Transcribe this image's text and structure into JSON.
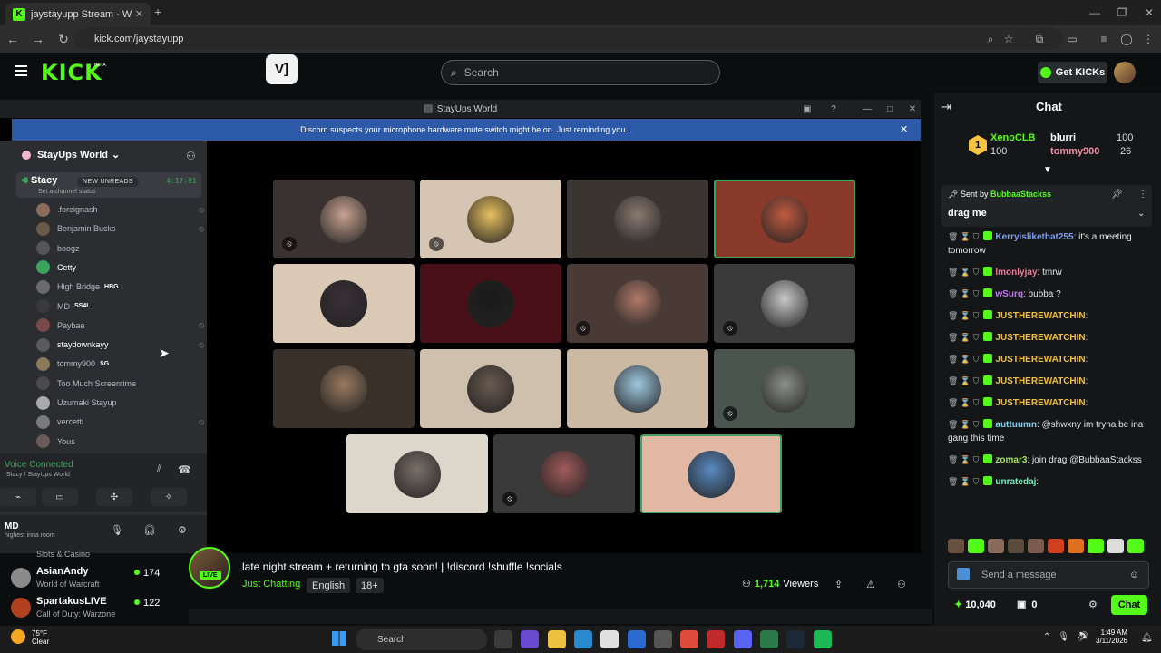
{
  "browser": {
    "tab_title": "jaystayupp Stream - Watch Live",
    "tab_favicon": "K",
    "url": "kick.com/jaystayupp",
    "new_tab": "+"
  },
  "kick": {
    "logo": "KICK",
    "beta": "BETA",
    "app_icon": "V]",
    "search_placeholder": "Search",
    "get_kicks": "Get KICKs"
  },
  "discord": {
    "window_title": "StayUps World",
    "banner": "Discord suspects your microphone hardware mute switch might be on. Just reminding you...",
    "server_name": "StayUps World",
    "channel_name": "Stacy",
    "new_unreads": "NEW UNREADS",
    "channel_time": "4:17:01",
    "channel_status": "Set a channel status",
    "members": [
      {
        "name": ".foreignash",
        "tag": "",
        "color": "#8b6b5a",
        "muted": true
      },
      {
        "name": "Benjamin Bucks",
        "tag": "",
        "color": "#6b5a4a",
        "muted": true
      },
      {
        "name": "boogz",
        "tag": "",
        "color": "#555555",
        "muted": false
      },
      {
        "name": "Cetty",
        "tag": "",
        "color": "#3ba55d",
        "muted": false,
        "bright": true
      },
      {
        "name": "High Bridge",
        "tag": "HBG",
        "color": "#6a6a6a",
        "muted": false
      },
      {
        "name": "MD",
        "tag": "SS4L",
        "color": "#3a3a3a",
        "muted": false
      },
      {
        "name": "Paybae",
        "tag": "",
        "color": "#7a4a4a",
        "muted": true
      },
      {
        "name": "staydownkayy",
        "tag": "",
        "color": "#5a5a5a",
        "muted": true,
        "bright": true
      },
      {
        "name": "tommy900",
        "tag": "SG",
        "color": "#8a7a5a",
        "muted": false
      },
      {
        "name": "Too Much Screentime",
        "tag": "",
        "color": "#4a4a4a",
        "muted": false
      },
      {
        "name": "Uzumaki Stayup",
        "tag": "",
        "color": "#aaaaaa",
        "muted": false
      },
      {
        "name": "vercetti",
        "tag": "",
        "color": "#7a7a7a",
        "muted": true
      },
      {
        "name": "Yous",
        "tag": "",
        "color": "#6a5a5a",
        "muted": false
      }
    ],
    "voice_connected": "Voice Connected",
    "voice_sub": "Stacy / StayUps World",
    "user_name": "MD",
    "user_status": "highest inna room"
  },
  "tiles": [
    {
      "bg": "#3a3230",
      "pic": "#c8a290",
      "muted": true,
      "speaking": false
    },
    {
      "bg": "#d6c5b2",
      "pic": "#e8c060",
      "muted": true,
      "speaking": false
    },
    {
      "bg": "#3a3530",
      "pic": "#8a7a70",
      "muted": false,
      "speaking": false
    },
    {
      "bg": "#8a3a2a",
      "pic": "#c05a40",
      "muted": false,
      "speaking": true
    },
    {
      "bg": "#d9c9b5",
      "pic": "#3a3038",
      "muted": false,
      "speaking": false
    },
    {
      "bg": "#4a1018",
      "pic": "#1a1a1a",
      "muted": false,
      "speaking": false
    },
    {
      "bg": "#4a3a35",
      "pic": "#b07a6a",
      "muted": true,
      "speaking": false
    },
    {
      "bg": "#3a3a3a",
      "pic": "#c8c8c8",
      "muted": true,
      "speaking": false
    },
    {
      "bg": "#3a302a",
      "pic": "#9a7a60",
      "muted": false,
      "speaking": false
    },
    {
      "bg": "#cfc0ad",
      "pic": "#6a5a50",
      "muted": false,
      "speaking": false
    },
    {
      "bg": "#cbb9a4",
      "pic": "#a0c8e0",
      "muted": false,
      "speaking": false
    },
    {
      "bg": "#4a5550",
      "pic": "#8a9088",
      "muted": true,
      "speaking": false
    },
    {
      "bg": "#ddd6cb",
      "pic": "#7a7068",
      "muted": false,
      "speaking": false
    },
    {
      "bg": "#3a3a3a",
      "pic": "#a05a5a",
      "muted": true,
      "speaking": false
    },
    {
      "bg": "#e0b8a4",
      "pic": "#5a8ac0",
      "muted": false,
      "speaking": true
    }
  ],
  "stream": {
    "live": "LIVE",
    "title": "late night stream + returning to gta soon! | !discord !shuffle !socials",
    "category": "Just Chatting",
    "language": "English",
    "rating": "18+",
    "viewers_count": "1,714",
    "viewers_label": "Viewers"
  },
  "sidebar": {
    "partial_label": "Slots & Casino",
    "recommended": [
      {
        "name": "AsianAndy",
        "game": "World of Warcraft",
        "viewers": "174",
        "color": "#8a8a8a"
      },
      {
        "name": "SpartakusLIVE",
        "game": "Call of Duty: Warzone",
        "viewers": "122",
        "color": "#b04020"
      }
    ]
  },
  "chat": {
    "title": "Chat",
    "leaderboard": {
      "rank": "1",
      "first_name": "XenoCLB",
      "first_score": "100",
      "second_name": "blurri",
      "second_score": "100",
      "third_name": "tommy900",
      "third_score": "26"
    },
    "pinned_by_label": "Sent by",
    "pinned_by": "BubbaaStackss",
    "pinned_message": "drag me",
    "messages": [
      {
        "user": "Kerryislikethat255",
        "color": "#7a9cf0",
        "text": ": it's a meeting tomorrow"
      },
      {
        "user": "lmonlyjay",
        "color": "#e87a9a",
        "text": ": tmrw"
      },
      {
        "user": "wSurq",
        "color": "#c07af0",
        "text": ": bubba ?"
      },
      {
        "user": "JUSTHEREWATCHIN",
        "color": "#f0c040",
        "text": ":"
      },
      {
        "user": "JUSTHEREWATCHIN",
        "color": "#f0c040",
        "text": ":"
      },
      {
        "user": "JUSTHEREWATCHIN",
        "color": "#f0c040",
        "text": ":"
      },
      {
        "user": "JUSTHEREWATCHIN",
        "color": "#f0c040",
        "text": ":"
      },
      {
        "user": "JUSTHEREWATCHIN",
        "color": "#f0c040",
        "text": ":"
      },
      {
        "user": "auttuumn",
        "color": "#7ad0f0",
        "text": ": @shwxny im tryna be ina gang this time"
      },
      {
        "user": "zomar3",
        "color": "#a0e060",
        "text": ": join drag @BubbaaStackss"
      },
      {
        "user": "unratedaj",
        "color": "#7af0c0",
        "text": ":"
      }
    ],
    "send_placeholder": "Send a message",
    "points": "10,040",
    "kicks": "0",
    "chat_button": "Chat"
  },
  "taskbar": {
    "temp": "75°F",
    "weather": "Clear",
    "search": "Search",
    "time": "1:49 AM",
    "date": "3/11/2026"
  }
}
